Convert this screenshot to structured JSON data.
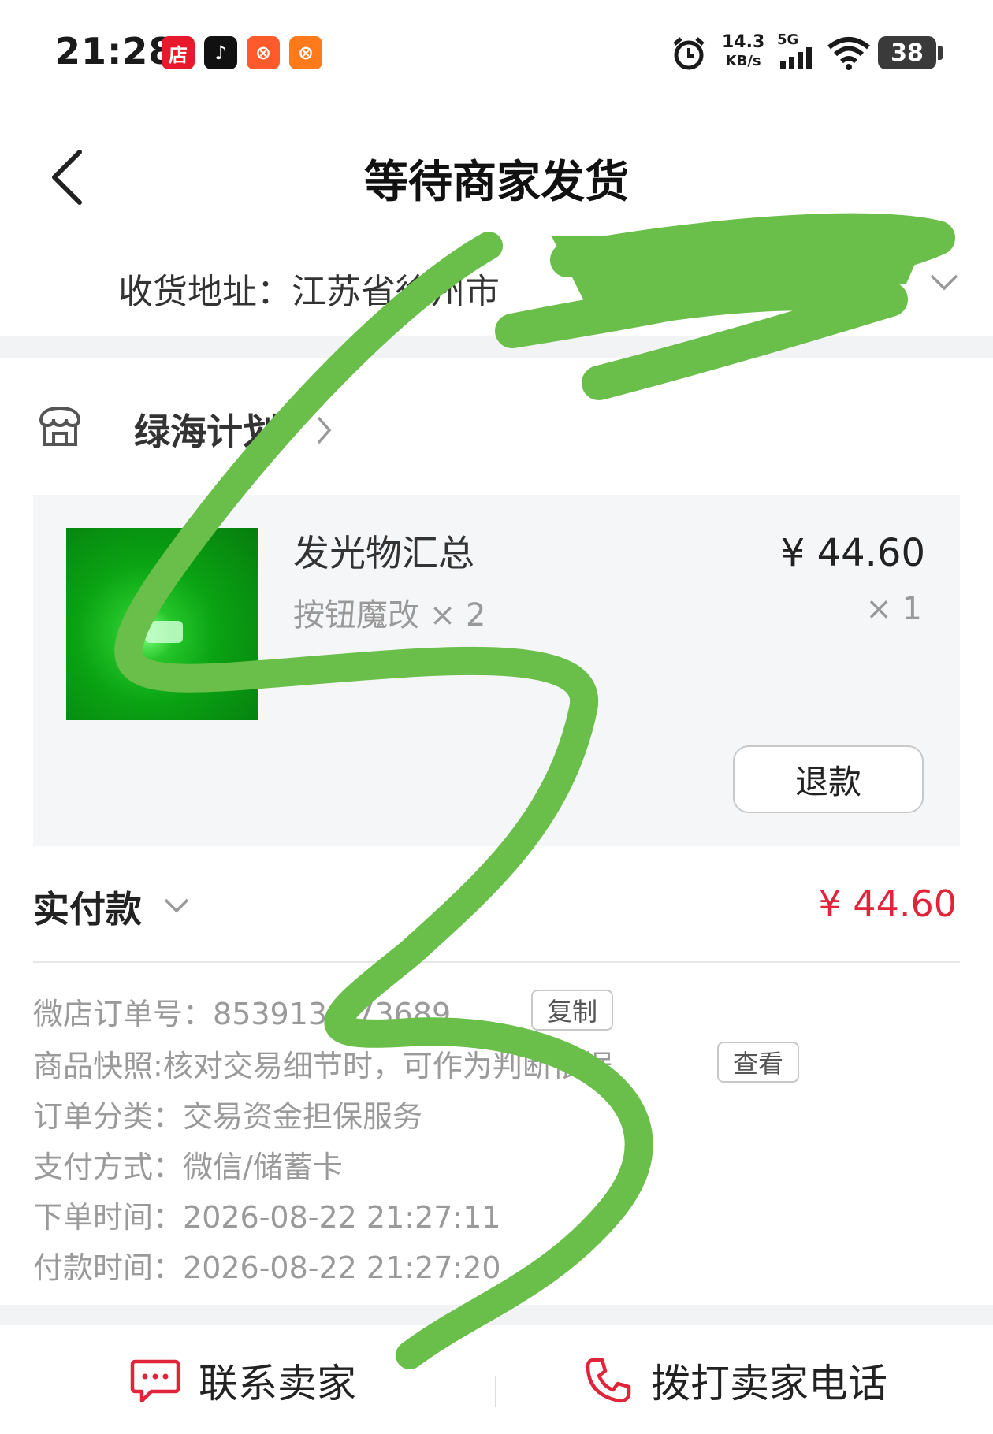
{
  "status_bar": {
    "time": "21:28",
    "apps": [
      {
        "icon": "shop-app-icon",
        "glyph": "店",
        "color": "#e8192c"
      },
      {
        "icon": "douyin-icon",
        "glyph": "♪",
        "color": "#111111"
      },
      {
        "icon": "kuaishou-icon",
        "glyph": "⊗",
        "color": "#ff5a2b"
      },
      {
        "icon": "kuaishou-lite-icon",
        "glyph": "⊗",
        "color": "#ff7a1a"
      }
    ],
    "net_speed": "14.3",
    "net_unit": "KB/s",
    "network": "5G",
    "battery": "38"
  },
  "header": {
    "title": "等待商家发货"
  },
  "address": {
    "text": "收货地址：江苏省徐州市"
  },
  "shop": {
    "name": "绿海计划"
  },
  "item": {
    "title": "发光物汇总",
    "spec": "按钮魔改 × 2",
    "price": "¥ 44.60",
    "quantity": "× 1",
    "refund_label": "退款"
  },
  "payment": {
    "label": "实付款",
    "amount": "¥ 44.60",
    "accent_color": "#e0243a"
  },
  "order_info": {
    "order_no_label": "微店订单号：",
    "order_no": "853913   273689",
    "copy_label": "复制",
    "snapshot_label": "商品快照:",
    "snapshot_text": "核对交易细节时，可作为判断依据",
    "view_label": "查看",
    "category_label": "订单分类：",
    "category": "交易资金担保服务",
    "pay_method_label": "支付方式：",
    "pay_method": "微信/储蓄卡",
    "order_time_label": "下单时间：",
    "order_time": "2026-08-22 21:27:11",
    "pay_time_label": "付款时间：",
    "pay_time": "2026-08-22 21:27:20"
  },
  "bottom_bar": {
    "contact_label": "联系卖家",
    "call_label": "拨打卖家电话"
  },
  "annotation": {
    "scribble_color": "#6abf4b"
  }
}
